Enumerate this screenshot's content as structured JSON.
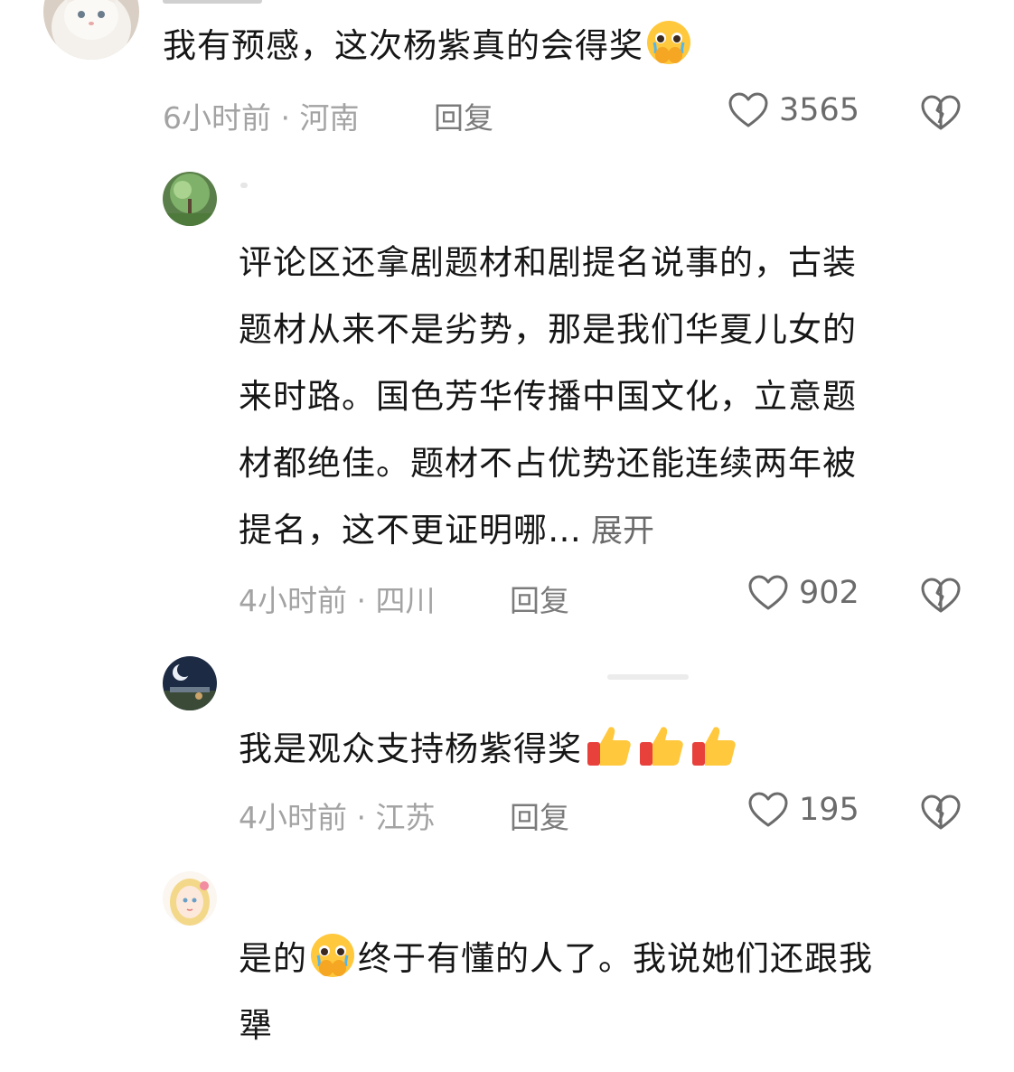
{
  "comments": [
    {
      "text_lines": [
        "我有预感，这次杨紫真的会得奖"
      ],
      "emoji_icon": "covering-mouth-crying-emoji",
      "time": "6小时前",
      "location": "河南",
      "reply_label": "回复",
      "likes": "3565"
    },
    {
      "text_lines": [
        "评论区还拿剧题材和剧提名说事的，古装",
        "题材从来不是劣势，那是我们华夏儿女的",
        "来时路。国色芳华传播中国文化，立意题",
        "材都绝佳。题材不占优势还能连续两年被",
        "提名，这不更证明哪…"
      ],
      "expand_label": "展开",
      "time": "4小时前",
      "location": "四川",
      "reply_label": "回复",
      "likes": "902"
    },
    {
      "text_lines": [
        "我是观众支持杨紫得奖"
      ],
      "emoji_icon": "thumbs-up-emoji",
      "time": "4小时前",
      "location": "江苏",
      "reply_label": "回复",
      "likes": "195"
    },
    {
      "text_before_emoji": "是的",
      "emoji_icon": "covering-mouth-crying-emoji",
      "text_after_emoji": "终于有懂的人了。我说她们还跟我",
      "text_line2": "犟"
    }
  ],
  "meta_separator": " · ",
  "colors": {
    "text": "#161616",
    "meta": "#a3a3a3",
    "reply": "#7b7b7b",
    "icon": "#6b6b6b"
  }
}
